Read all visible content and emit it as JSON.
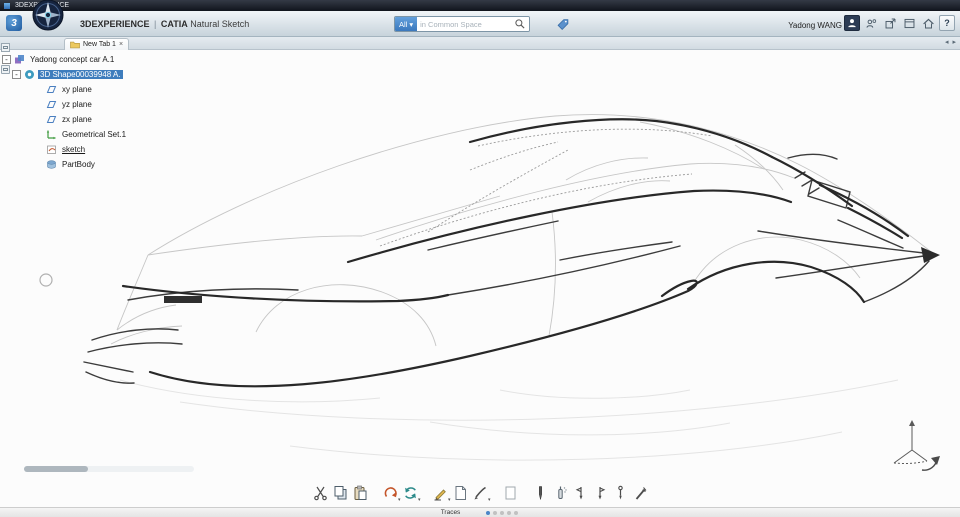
{
  "window": {
    "title": "3DEXPERIENCE"
  },
  "header": {
    "brand": {
      "name": "3DEXPERIENCE",
      "divider": "|",
      "app": "CATIA",
      "module": "Natural Sketch"
    },
    "search": {
      "scope": "All",
      "caret": "▾",
      "placeholder": "in Common Space"
    },
    "user": "Yadong WANG",
    "help_label": "?",
    "icons": [
      "avatar-icon",
      "collaboration-icon",
      "export-icon",
      "share-icon",
      "home-icon",
      "help-icon",
      "tag-icon",
      "search-icon"
    ]
  },
  "tabs": {
    "active": "New Tab 1",
    "close": "×",
    "nav_back": "◂",
    "nav_fwd": "▸"
  },
  "tree": {
    "root": {
      "label": "Yadong concept car A.1",
      "icon": "product-icon",
      "expander": "-"
    },
    "items": [
      {
        "label": "3D Shape00039948 A.",
        "icon": "shape-icon",
        "selected": true,
        "expander": "-"
      },
      {
        "label": "xy plane",
        "icon": "plane-icon"
      },
      {
        "label": "yz plane",
        "icon": "plane-icon"
      },
      {
        "label": "zx plane",
        "icon": "plane-icon"
      },
      {
        "label": "Geometrical Set.1",
        "icon": "geometrical-set-icon"
      },
      {
        "label": "sketch",
        "icon": "sketch-icon",
        "underlined": true
      },
      {
        "label": "PartBody",
        "icon": "part-body-icon"
      }
    ]
  },
  "toolbar": {
    "items": [
      "cut",
      "copy",
      "paste",
      "undo",
      "update",
      "pencil",
      "paper",
      "brush",
      "sheet",
      "marker",
      "airbrush",
      "pin-back",
      "pin-forward",
      "stylus",
      "wand"
    ]
  },
  "viewport": {
    "content": "concept car line sketch",
    "widgets": [
      "rotation-circle",
      "axis-triad",
      "orbit-arrow"
    ]
  },
  "footer": {
    "label": "Traces",
    "page_count": 5,
    "active_page": 1
  },
  "colors": {
    "selection_blue": "#3e7dbd",
    "scope_blue": "#3a78bd",
    "undo_orange": "#c4552a",
    "update_teal": "#2c8a8a",
    "titlebar_dark": "#10141c"
  }
}
